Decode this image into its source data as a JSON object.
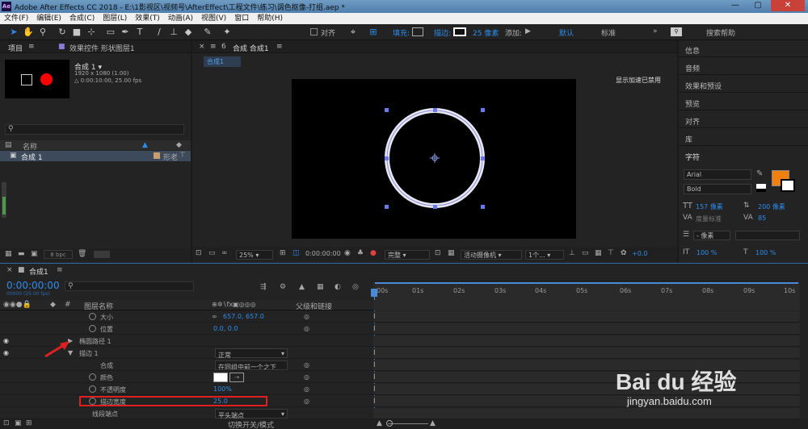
{
  "window": {
    "title": "Adobe After Effects CC 2018 - E:\\1影视区\\视频号\\AfterEffect\\工程文件\\练习\\调色抠像-打组.aep *",
    "minimize": "—",
    "maximize": "▢",
    "close": "✕"
  },
  "menu": [
    "文件(F)",
    "编辑(E)",
    "合成(C)",
    "图层(L)",
    "效果(T)",
    "动画(A)",
    "视图(V)",
    "窗口",
    "帮助(H)"
  ],
  "toolbar": {
    "align_label": "对齐",
    "fill_label": "填充:",
    "stroke_label": "描边:",
    "stroke_width": "25 像素",
    "add_label": "添加:",
    "workspace_default": "默认",
    "workspace_standard": "标准",
    "search_placeholder": "搜索帮助",
    "colors": {
      "accent": "#2d8ceb",
      "fill_swatch": "#000000",
      "stroke_swatch": "#ffffff"
    }
  },
  "project_panel": {
    "tab_project": "项目",
    "tab_effects": "效果控件 形状图层1",
    "comp_name": "合成 1 ▾",
    "comp_size": "1920 x 1080 (1.00)",
    "comp_duration": "△ 0:00:10:00, 25.00 fps",
    "column_name": "名称",
    "item_name": "合成 1",
    "item_type": "形老",
    "bpc": "8 bpc"
  },
  "viewer": {
    "tab_label": "合成 合成1",
    "sub_tab": "合成1",
    "accel_notice": "显示加速已禁用",
    "zoom": "25%",
    "timecode": "0:00:00:00",
    "quality": "完整",
    "camera": "活动摄像机",
    "views": "1个...",
    "exposure": "+0.0"
  },
  "right_panel": {
    "items": [
      "信息",
      "音频",
      "效果和预设",
      "预览",
      "对齐",
      "库"
    ],
    "character_title": "字符",
    "font": "Arial",
    "font_style": "Bold",
    "font_size": "157 像素",
    "leading": "200 像素",
    "kerning": "度量标准",
    "tracking": "85",
    "stroke_px": "- 像素",
    "vscale": "100 %",
    "hscale": "100 %",
    "color_swatch": "#f08010"
  },
  "timeline": {
    "tab_label": "合成1",
    "timecode": "0:00:00:00",
    "timecode_sub": "00000 (25.00 fps)",
    "col_layer_name": "图层名称",
    "col_parent": "父级和链接",
    "ruler": [
      "00s",
      "01s",
      "02s",
      "03s",
      "04s",
      "05s",
      "06s",
      "07s",
      "08s",
      "09s",
      "10s"
    ],
    "rows": [
      {
        "name": "大小",
        "value": "657.0, 657.0"
      },
      {
        "name": "位置",
        "value": "0.0, 0.0"
      },
      {
        "name": "椭圆路径 1",
        "value": ""
      },
      {
        "name": "描边 1",
        "value": "正常"
      },
      {
        "name": "合成",
        "value": "在同组中前一个之下"
      },
      {
        "name": "颜色",
        "value": ""
      },
      {
        "name": "不透明度",
        "value": "100%"
      },
      {
        "name": "描边宽度",
        "value": "25.0"
      },
      {
        "name": "线段端点",
        "value": "平头端点"
      }
    ],
    "footer_label": "切换开关/模式"
  },
  "watermark": {
    "brand": "Bai du 经验",
    "url": "jingyan.baidu.com"
  }
}
